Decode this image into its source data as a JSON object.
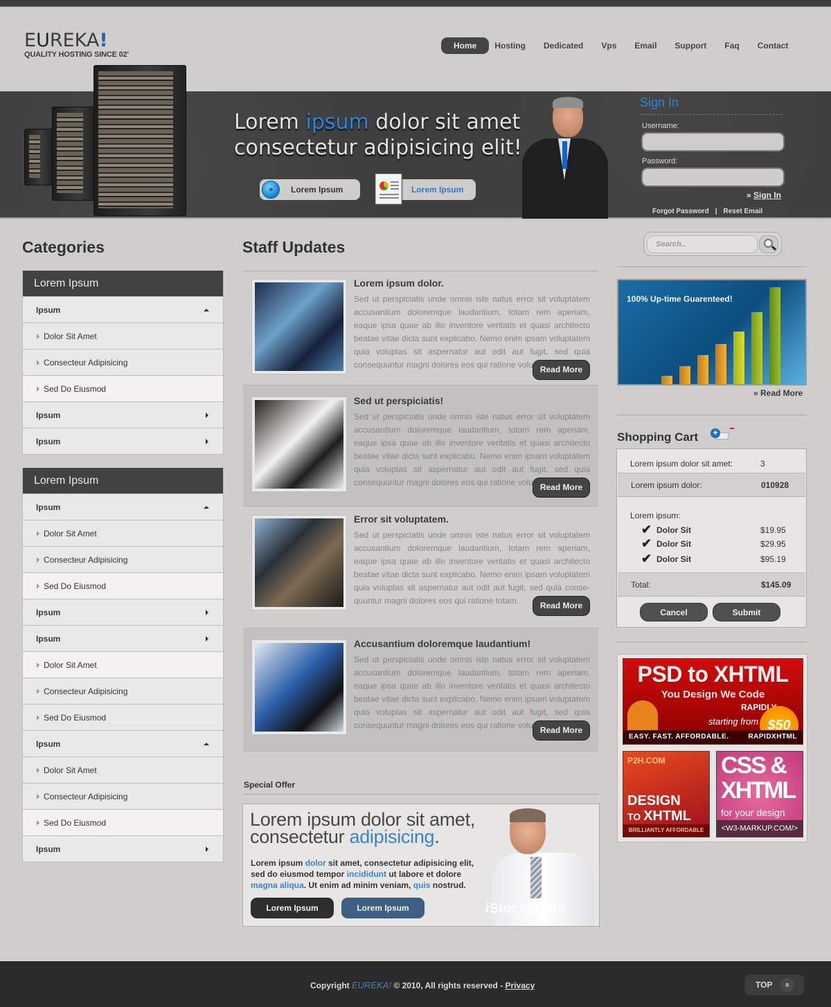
{
  "header": {
    "logo": {
      "prefix": "E",
      "u": "U",
      "rest": "REKA",
      "bang": "!",
      "tagline": "QUALITY HOSTING SINCE 02'"
    },
    "nav": [
      {
        "label": "Home",
        "active": true
      },
      {
        "label": "Hosting"
      },
      {
        "label": "Dedicated"
      },
      {
        "label": "Vps"
      },
      {
        "label": "Email"
      },
      {
        "label": "Support"
      },
      {
        "label": "Faq"
      },
      {
        "label": "Contact"
      }
    ]
  },
  "hero": {
    "headline_part1": "Lorem ",
    "headline_highlight": "ipsum",
    "headline_part2": " dolor sit amet",
    "headline_line2": "consectetur adipisicing elit!",
    "button1": "Lorem Ipsum",
    "button2": "Lorem Ipsum"
  },
  "signin": {
    "title": "Sign In",
    "username_label": "Username:",
    "username_value": "",
    "password_label": "Password:",
    "password_value": "",
    "submit_prefix": "» ",
    "submit_label": "Sign In",
    "forgot": "Forgot Password",
    "separator": "|",
    "reset": "Reset Email"
  },
  "categories": {
    "title": "Categories",
    "boxes": [
      {
        "header": "Lorem Ipsum",
        "rows": [
          {
            "type": "top",
            "label": "Ipsum",
            "arrow": "up"
          },
          {
            "type": "sub",
            "label": "Dolor Sit Amet"
          },
          {
            "type": "sub",
            "label": "Consecteur Adipisicing"
          },
          {
            "type": "sub",
            "label": "Sed Do Eiusmod",
            "light": true
          },
          {
            "type": "top",
            "label": "Ipsum",
            "arrow": "right"
          },
          {
            "type": "top",
            "label": "Ipsum",
            "arrow": "right"
          }
        ]
      },
      {
        "header": "Lorem Ipsum",
        "rows": [
          {
            "type": "top",
            "label": "Ipsum",
            "arrow": "up"
          },
          {
            "type": "sub",
            "label": "Dolor Sit Amet"
          },
          {
            "type": "sub",
            "label": "Consecteur Adipisicing"
          },
          {
            "type": "sub",
            "label": "Sed Do Eiusmod",
            "light": true
          },
          {
            "type": "top",
            "label": "Ipsum",
            "arrow": "right"
          },
          {
            "type": "top",
            "label": "Ipsum",
            "arrow": "right"
          },
          {
            "type": "sub",
            "label": "Dolor Sit Amet",
            "light": true
          },
          {
            "type": "sub",
            "label": "Consecteur Adipisicing"
          },
          {
            "type": "sub",
            "label": "Sed Do Eiusmod"
          },
          {
            "type": "top",
            "label": "Ipsum",
            "arrow": "up"
          },
          {
            "type": "sub",
            "label": "Dolor Sit Amet"
          },
          {
            "type": "sub",
            "label": "Consecteur Adipisicing"
          },
          {
            "type": "sub",
            "label": "Sed Do Eiusmod",
            "light": true
          },
          {
            "type": "top",
            "label": "Ipsum",
            "arrow": "right"
          }
        ]
      }
    ]
  },
  "staff": {
    "title": "Staff Updates",
    "posts": [
      {
        "title": "Lorem ipsum dolor.",
        "body": "Sed ut perspiciatis unde omnis iste natus error sit voluptatem accusantium doloremque laudantium, totam rem aperiam, eaque ipsa quae ab illo inventore veritatis et quasi architecto beatae vitae dicta sunt explicabo. Nemo enim ipsam voluptatem quia voluptas sit aspernatur aut odit aut fugit, sed quia consequuntur magni dolores eos qui ratione voluptatem",
        "button": "Read More",
        "image": "people-on-stairs"
      },
      {
        "title": "Sed ut perspiciatis!",
        "body": "Sed ut perspiciatis unde omnis iste natus error sit voluptatem accusantium doloremque laudantium, totam rem aperiam, eaque ipsa quae ab illo inventore veritatis et quasi architecto beatae vitae dicta sunt explicabo. Nemo enim ipsam voluptatem quia voluptas sit aspernatur aut odit aut fugit, sed quia consequuntur magni dolores eos qui ratione voluptatem",
        "button": "Read More",
        "image": "business-team"
      },
      {
        "title": "Error sit voluptatem.",
        "body": "Sed ut perspiciatis unde omnis iste natus error sit voluptatem accusantium doloremque laudantium, totam rem aperiam, eaque ipsa quae ab illo inventore veritatis et quasi architecto beatae vitae dicta sunt explicabo. Nemo enim ipsam voluptatem quia voluptas sit aspernatur aut odit aut fugit, sed quia conse-quuntur magni dolores eos qui ratione totam.",
        "button": "Read More",
        "image": "office-building"
      },
      {
        "title": "Accusantium doloremque laudantium!",
        "body": "Sed ut perspiciatis unde omnis iste natus error sit voluptatem accusantium doloremque laudantium, totam rem aperiam, eaque ipsa quae ab illo inventore veritatis et quasi architecto beatae vitae dicta sunt explicabo. Nemo enim ipsam voluptatem quia voluptas sit aspernatur aut odit aut fugit, sed quia consequuntur magni dolores eos qui ratione voluptatem",
        "button": "Read More",
        "image": "smiling-businessman"
      }
    ]
  },
  "special": {
    "label": "Special Offer",
    "headline1": "Lorem ipsum dolor sit amet,",
    "headline2_a": "consectetur ",
    "headline2_hl": "adipisicing",
    "headline2_b": ".",
    "body": [
      {
        "t": "Lorem ipsum "
      },
      {
        "t": "dolor",
        "hl": true
      },
      {
        "t": " sit amet, consectetur adipisicing elit, sed do eiusmod tempor "
      },
      {
        "t": "incididunt",
        "hl": true
      },
      {
        "t": " ut labore et dolore "
      },
      {
        "t": "magna aliqua",
        "hl": true
      },
      {
        "t": ". Ut enim ad minim veniam, "
      },
      {
        "t": "quis",
        "hl": true
      },
      {
        "t": " nostrud."
      }
    ],
    "button1": "Lorem Ipsum",
    "button2": "Lorem Ipsum",
    "watermark": "iStockphoto"
  },
  "sidebar": {
    "search_placeholder": "Search..",
    "search_value": "",
    "banner_text": "100% Up-time Guarenteed!",
    "banner_read_more": "» Read More",
    "cart": {
      "title": "Shopping Cart",
      "row1_key": "Lorem ipsum dolor sit amet:",
      "row1_value": "3",
      "row2_key": "Lorem ipsum dolor:",
      "row2_value": "010928",
      "items_label": "Lorem ipsum:",
      "items": [
        {
          "name": "Dolor Sit",
          "price": "$19.95"
        },
        {
          "name": "Dolor Sit",
          "price": "$29.95"
        },
        {
          "name": "Dolor Sit",
          "price": "$95.19"
        }
      ],
      "total_label": "Total:",
      "total_value": "$145.09",
      "cancel": "Cancel",
      "submit": "Submit"
    },
    "ads": {
      "ad1_title": "PSD to XHTML",
      "ad1_line2": "You Design We Code",
      "ad1_line3": "RAPIDLY",
      "ad1_line4": "starting from",
      "ad1_price": "$50",
      "ad1_foot_left": "EASY. FAST. AFFORDABLE.",
      "ad1_foot_right": "RAPIDXHTML",
      "ad2_brand": "P2H.COM",
      "ad2_line1": "DESIGN",
      "ad2_line2_small": "TO ",
      "ad2_line2": "XHTML",
      "ad2_foot": "BRILLIANTLY AFFORDABLE",
      "ad3_line1": "CSS &",
      "ad3_line2": "XHTML",
      "ad3_line3": "for your design",
      "ad3_foot": "<W3-MARKUP.COM/>"
    }
  },
  "footer": {
    "copy_prefix": "Copyright ",
    "brand": "EUREKA!",
    "copy_suffix": " © 2010, All rights reserved - ",
    "privacy": "Privacy",
    "top": "TOP",
    "top_icon": "»"
  }
}
